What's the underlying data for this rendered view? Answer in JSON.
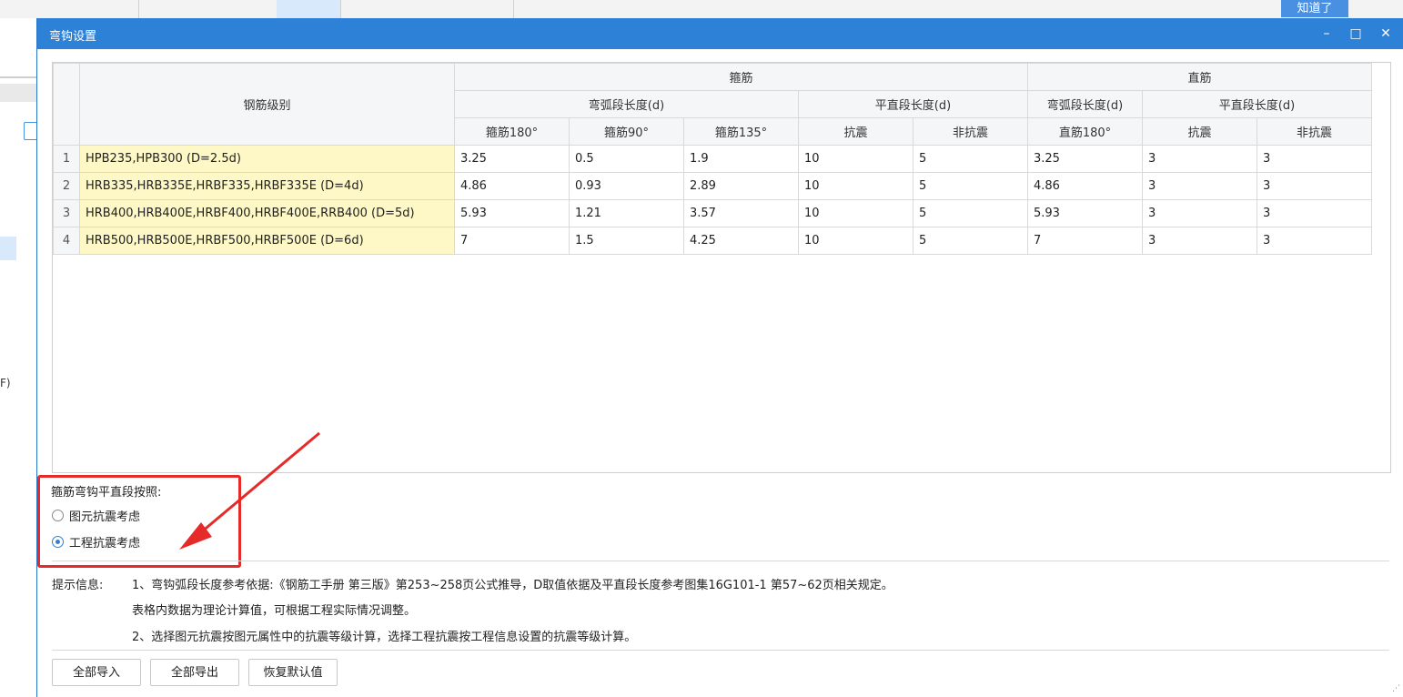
{
  "background": {
    "notice_button": "知道了",
    "left_fragment": "F)"
  },
  "dialog": {
    "title": "弯钩设置",
    "controls": {
      "minimize": "–",
      "maximize": "□",
      "close": "✕"
    }
  },
  "table": {
    "header_grade": "钢筋级别",
    "group_stirrup": "箍筋",
    "group_straight": "直筋",
    "sub_arc_length": "弯弧段长度(d)",
    "sub_straight_length": "平直段长度(d)",
    "cols": [
      "箍筋180°",
      "箍筋90°",
      "箍筋135°",
      "抗震",
      "非抗震",
      "直筋180°",
      "抗震",
      "非抗震"
    ],
    "rows": [
      {
        "idx": "1",
        "grade": "HPB235,HPB300 (D=2.5d)",
        "values": [
          "3.25",
          "0.5",
          "1.9",
          "10",
          "5",
          "3.25",
          "3",
          "3"
        ]
      },
      {
        "idx": "2",
        "grade": "HRB335,HRB335E,HRBF335,HRBF335E (D=4d)",
        "values": [
          "4.86",
          "0.93",
          "2.89",
          "10",
          "5",
          "4.86",
          "3",
          "3"
        ]
      },
      {
        "idx": "3",
        "grade": "HRB400,HRB400E,HRBF400,HRBF400E,RRB400 (D=5d)",
        "values": [
          "5.93",
          "1.21",
          "3.57",
          "10",
          "5",
          "5.93",
          "3",
          "3"
        ]
      },
      {
        "idx": "4",
        "grade": "HRB500,HRB500E,HRBF500,HRBF500E (D=6d)",
        "values": [
          "7",
          "1.5",
          "4.25",
          "10",
          "5",
          "7",
          "3",
          "3"
        ]
      }
    ]
  },
  "radio_group": {
    "title": "箍筋弯钩平直段按照:",
    "options": [
      {
        "label": "图元抗震考虑",
        "selected": false
      },
      {
        "label": "工程抗震考虑",
        "selected": true
      }
    ]
  },
  "tips": {
    "label": "提示信息:",
    "line1": "1、弯钩弧段长度参考依据:《钢筋工手册 第三版》第253~258页公式推导，D取值依据及平直段长度参考图集16G101-1 第57~62页相关规定。",
    "line2": "表格内数据为理论计算值，可根据工程实际情况调整。",
    "line3": "2、选择图元抗震按图元属性中的抗震等级计算，选择工程抗震按工程信息设置的抗震等级计算。"
  },
  "buttons": {
    "import_all": "全部导入",
    "export_all": "全部导出",
    "restore_default": "恢复默认值"
  },
  "colors": {
    "titlebar": "#2d82d8",
    "grade_cell": "#fdf8c5",
    "highlight_box": "#e62a2a"
  }
}
